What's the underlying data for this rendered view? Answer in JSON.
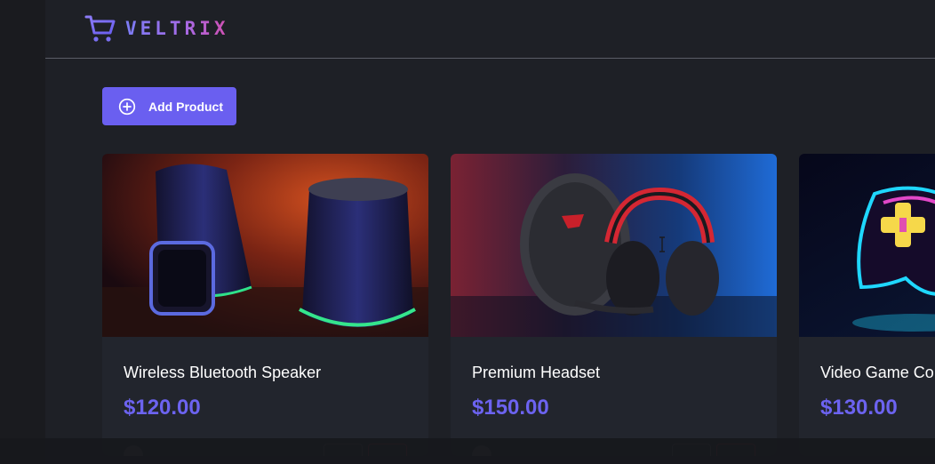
{
  "header": {
    "brand": "VELTRIX",
    "logo_icon": "shopping-cart-icon",
    "brand_gradient": [
      "#7b7cf5",
      "#a46be8",
      "#d24fb0"
    ]
  },
  "actions": {
    "add_product_label": "Add Product",
    "add_product_icon": "plus-circle-icon",
    "accent": "#6a5ff0"
  },
  "products": [
    {
      "name": "Wireless Bluetooth Speaker",
      "price": "$120.00",
      "image": "speaker-and-smartwatch-photo"
    },
    {
      "name": "Premium Headset",
      "price": "$150.00",
      "image": "gaming-headset-photo"
    },
    {
      "name": "Video Game Co",
      "price": "$130.00",
      "image": "neon-game-controller-photo"
    }
  ],
  "colors": {
    "background": "#1e2026",
    "card": "#22252d",
    "price": "#6c63f0"
  }
}
